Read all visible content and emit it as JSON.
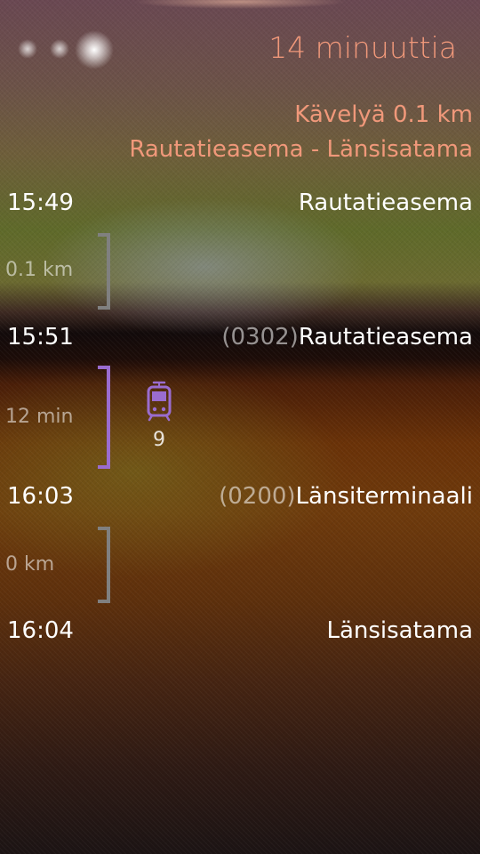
{
  "header": {
    "duration": "14 minuuttia",
    "walk_summary": "Kävelyä 0.1 km",
    "route_summary": "Rautatieasema - Länsisatama"
  },
  "stops": [
    {
      "time": "15:49",
      "code": "",
      "name": "Rautatieasema"
    },
    {
      "time": "15:51",
      "code": "(0302)",
      "name": "Rautatieasema"
    },
    {
      "time": "16:03",
      "code": "(0200)",
      "name": "Länsiterminaali"
    },
    {
      "time": "16:04",
      "code": "",
      "name": "Länsisatama"
    }
  ],
  "legs": [
    {
      "type": "walk",
      "label": "0.1 km",
      "color": "#808080"
    },
    {
      "type": "tram",
      "label": "12 min",
      "line": "9",
      "icon": "tram-icon",
      "color": "#9a6ccf"
    },
    {
      "type": "walk",
      "label": "0 km",
      "color": "#808080"
    }
  ],
  "colors": {
    "accent": "#f0987a",
    "tram": "#9a6ccf",
    "walk": "#808080"
  }
}
